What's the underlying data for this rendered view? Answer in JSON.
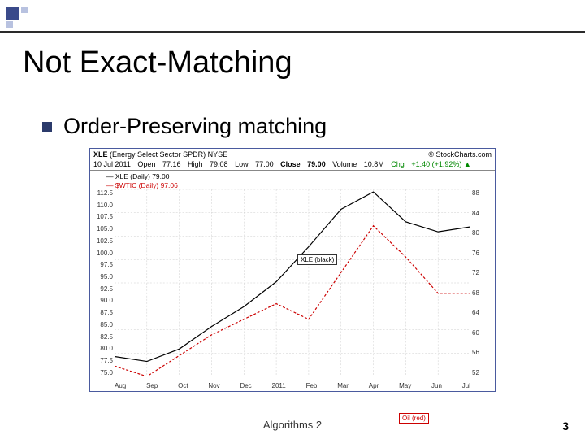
{
  "slide": {
    "title": "Not Exact-Matching",
    "bullet": "Order-Preserving matching"
  },
  "chart": {
    "symbol": "XLE",
    "symbol_desc": "(Energy Select Sector SPDR) NYSE",
    "source": "© StockCharts.com",
    "date": "10 Jul 2011",
    "quotes": {
      "open_label": "Open",
      "open": "77.16",
      "high_label": "High",
      "high": "79.08",
      "low_label": "Low",
      "low": "77.00",
      "close_label": "Close",
      "close": "79.00",
      "vol_label": "Volume",
      "vol": "10.8M",
      "chg_label": "Chg",
      "chg": "+1.40 (+1.92%) ▲"
    },
    "legend_xle": "— XLE (Daily) 79.00",
    "legend_oil": "— $WTIC (Daily) 97.06",
    "label_xle": "XLE (black)",
    "label_oil": "Oil (red)"
  },
  "chart_data": {
    "type": "line",
    "x_labels": [
      "Aug",
      "Sep",
      "Oct",
      "Nov",
      "Dec",
      "2011",
      "Feb",
      "Mar",
      "Apr",
      "May",
      "Jun",
      "Jul"
    ],
    "left_axis": {
      "label": "XLE",
      "ticks": [
        75.0,
        77.5,
        80.0,
        82.5,
        85.0,
        87.5,
        90.0,
        92.5,
        95.0,
        97.5,
        100.0,
        102.5,
        105.0,
        107.5,
        110.0,
        112.5
      ]
    },
    "right_axis": {
      "label": "Oil",
      "ticks": [
        52,
        56,
        60,
        64,
        68,
        72,
        76,
        80,
        84,
        88
      ]
    },
    "series": [
      {
        "name": "XLE (black)",
        "axis": "left",
        "color": "#000000",
        "values": [
          79.0,
          78.0,
          80.5,
          85.0,
          89.0,
          94.0,
          101.0,
          108.5,
          112.0,
          106.0,
          104.0,
          105.0
        ]
      },
      {
        "name": "Oil (red)",
        "axis": "right",
        "color": "#cc0000",
        "values": [
          54.0,
          52.0,
          56.0,
          60.0,
          63.0,
          66.0,
          63.0,
          72.0,
          81.0,
          75.0,
          68.0,
          68.0
        ]
      }
    ]
  },
  "footer": {
    "center": "Algorithms 2",
    "page": "3"
  }
}
